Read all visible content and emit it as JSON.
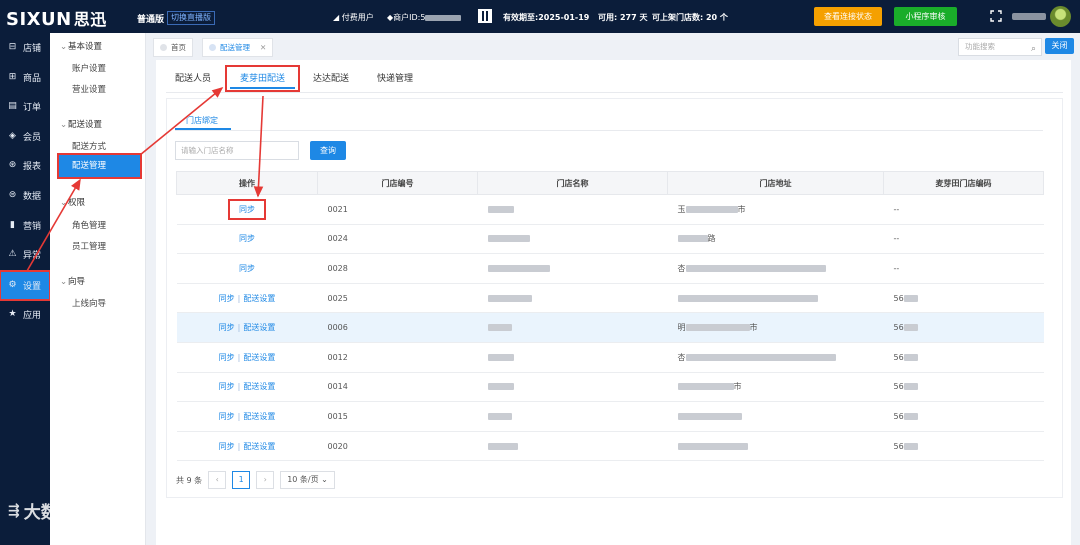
{
  "topbar": {
    "logo_en": "SIXUN",
    "logo_cn": "思迅",
    "edition": "普通版",
    "switch_link": "切换直播版",
    "paid_user": "付费用户",
    "merchant_id_label": "商户ID:5",
    "valid_until": "有效期至:2025-01-19",
    "usable": "可用: 277 天",
    "stores": "可上架门店数: 20 个",
    "btn_connect": "查看连接状态",
    "btn_miniapp": "小程序审核"
  },
  "sidebar": {
    "items": [
      {
        "label": "店铺",
        "icon": "store-icon"
      },
      {
        "label": "商品",
        "icon": "gift-icon"
      },
      {
        "label": "订单",
        "icon": "order-icon"
      },
      {
        "label": "会员",
        "icon": "member-icon"
      },
      {
        "label": "报表",
        "icon": "report-icon"
      },
      {
        "label": "数据",
        "icon": "data-icon"
      },
      {
        "label": "营销",
        "icon": "marketing-icon"
      },
      {
        "label": "异常",
        "icon": "warning-icon"
      },
      {
        "label": "设置",
        "icon": "gear-icon"
      },
      {
        "label": "应用",
        "icon": "star-icon"
      }
    ],
    "active_index": 8
  },
  "subnav": {
    "groups": [
      {
        "title": "基本设置",
        "items": [
          "账户设置",
          "营业设置"
        ]
      },
      {
        "title": "配送设置",
        "items": [
          "配送方式",
          "配送管理"
        ]
      },
      {
        "title": "权限",
        "items": [
          "角色管理",
          "员工管理"
        ]
      },
      {
        "title": "向导",
        "items": [
          "上线向导"
        ]
      }
    ],
    "active_item": "配送管理"
  },
  "tabs": {
    "home": "首页",
    "current": "配送管理",
    "search_placeholder": "功能搜索",
    "close_label": "关闭"
  },
  "content": {
    "tabs": [
      "配送人员",
      "麦芽田配送",
      "达达配送",
      "快递管理"
    ],
    "active_tab": "麦芽田配送",
    "subtab": "门店绑定",
    "store_name_placeholder": "请输入门店名称",
    "query_label": "查询",
    "table": {
      "columns": [
        "操作",
        "门店编号",
        "门店名称",
        "门店地址",
        "麦芽田门店编码"
      ],
      "rows": [
        {
          "ops": [
            "同步"
          ],
          "code": "0021",
          "name": "",
          "address": "玉",
          "address_tail": "市",
          "mytcode": "--"
        },
        {
          "ops": [
            "同步"
          ],
          "code": "0024",
          "name": "",
          "address": "",
          "address_tail": "路",
          "mytcode": "--"
        },
        {
          "ops": [
            "同步"
          ],
          "code": "0028",
          "name": "",
          "address": "杏",
          "address_tail": "",
          "mytcode": "--"
        },
        {
          "ops": [
            "同步",
            "配送设置"
          ],
          "code": "0025",
          "name": "",
          "address": "",
          "address_tail": "",
          "mytcode": "56"
        },
        {
          "ops": [
            "同步",
            "配送设置"
          ],
          "code": "0006",
          "name": "",
          "address": "明",
          "address_tail": "市",
          "mytcode": "56"
        },
        {
          "ops": [
            "同步",
            "配送设置"
          ],
          "code": "0012",
          "name": "",
          "address": "杏",
          "address_tail": "",
          "mytcode": "56"
        },
        {
          "ops": [
            "同步",
            "配送设置"
          ],
          "code": "0014",
          "name": "",
          "address": "",
          "address_tail": "市",
          "mytcode": "56"
        },
        {
          "ops": [
            "同步",
            "配送设置"
          ],
          "code": "0015",
          "name": "",
          "address": "",
          "address_tail": "",
          "mytcode": "56"
        },
        {
          "ops": [
            "同步",
            "配送设置"
          ],
          "code": "0020",
          "name": "",
          "address": "",
          "address_tail": "",
          "mytcode": "56"
        }
      ]
    },
    "pager": {
      "total": "共 9 条",
      "prev": "‹",
      "page": "1",
      "next": "›",
      "page_size": "10 条/页"
    }
  },
  "watermark": "大数跨境",
  "colors": {
    "nav_bg": "#0b1d3a",
    "primary": "#1e88e5",
    "highlight_box": "#e53935",
    "orange_btn": "#f5a000",
    "green_btn": "#1aad2a"
  }
}
